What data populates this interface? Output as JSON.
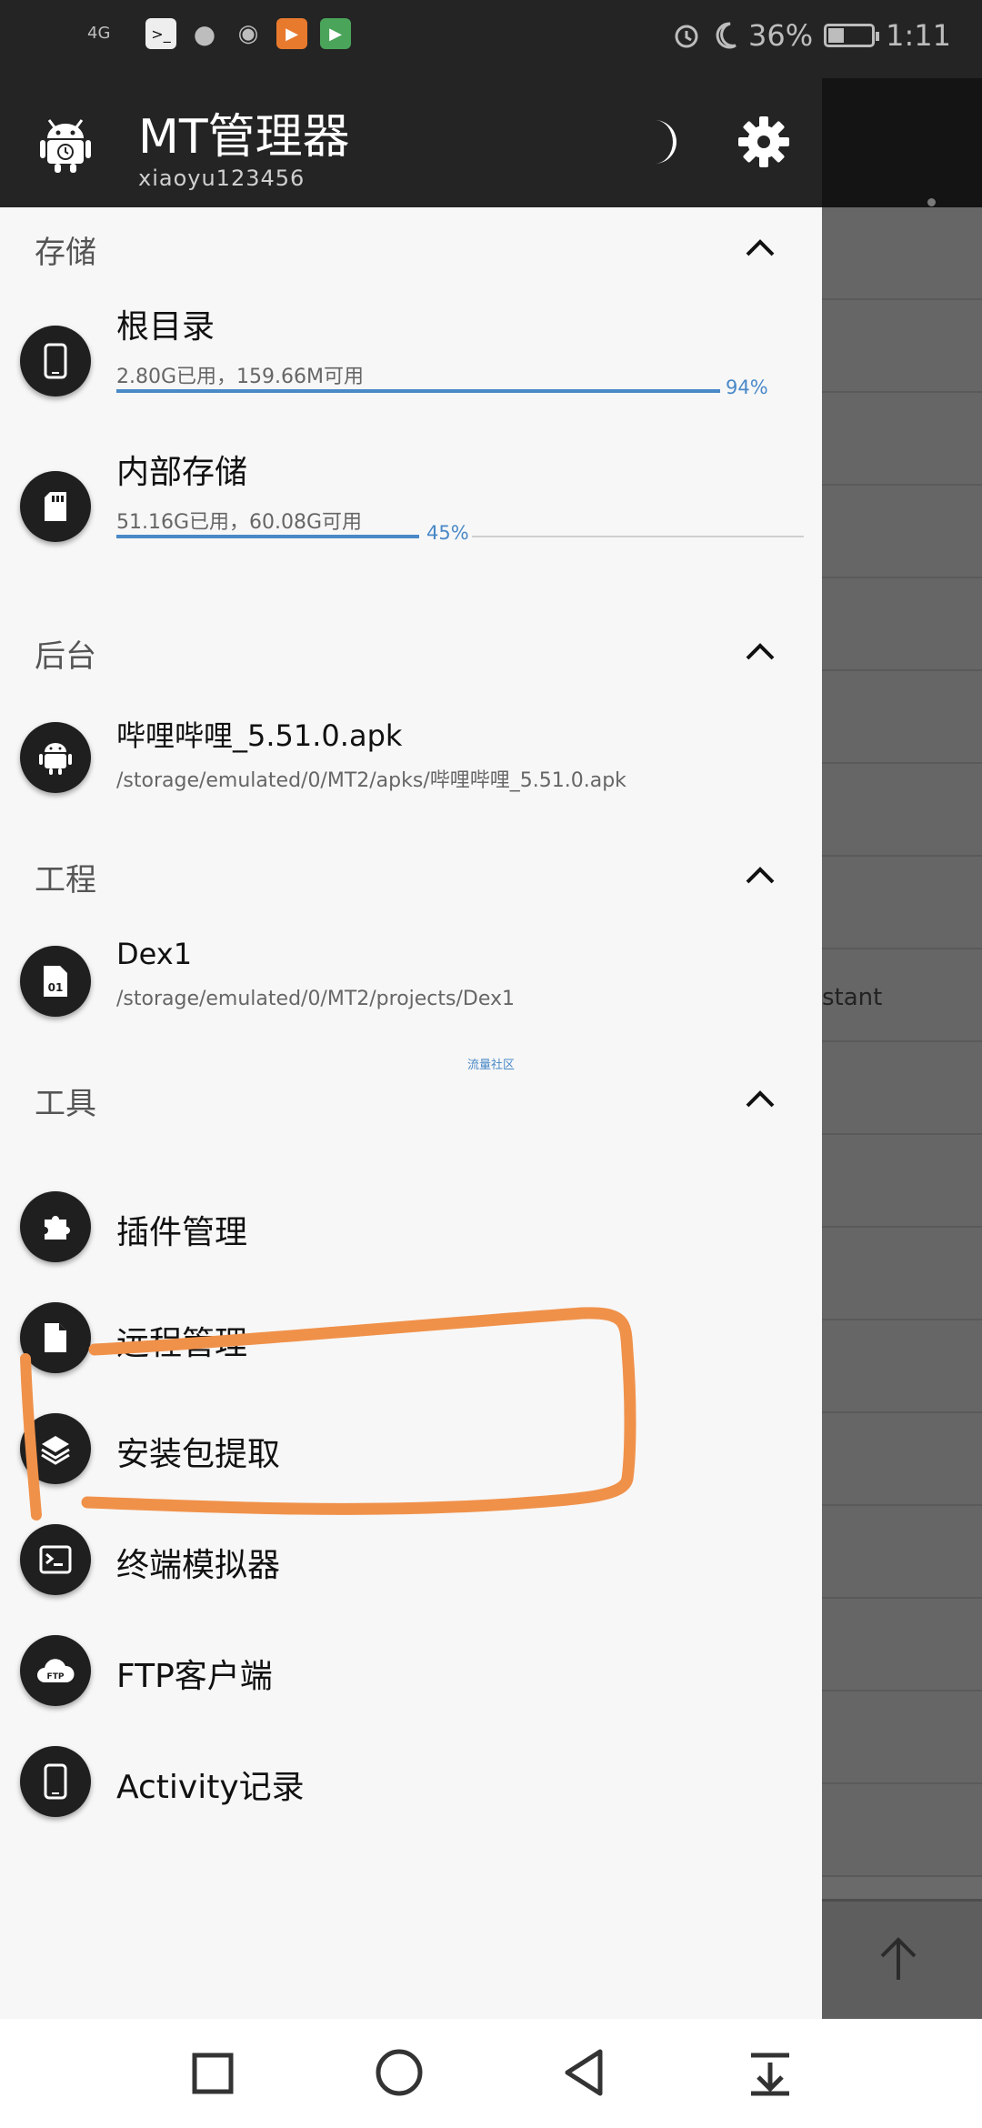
{
  "status_bar": {
    "signal": "4G",
    "battery_percent": "36%",
    "battery_level": 0.36,
    "time": "1:11",
    "icons": [
      "terminal-icon",
      "chat-icon",
      "wechat-icon",
      "video-app-icon",
      "play-app-icon",
      "alarm-icon",
      "moon-icon",
      "battery-icon"
    ]
  },
  "drawer": {
    "app_name": "MT管理器",
    "account": "xiaoyu123456",
    "sections": {
      "storage": {
        "title": "存储",
        "items": [
          {
            "title": "根目录",
            "usage": "2.80G已用，159.66M可用",
            "percent_label": "94%",
            "percent": 94,
            "icon": "phone-icon"
          },
          {
            "title": "内部存储",
            "usage": "51.16G已用，60.08G可用",
            "percent_label": "45%",
            "percent": 45,
            "icon": "sd-card-icon"
          }
        ]
      },
      "background": {
        "title": "后台",
        "items": [
          {
            "title": "哔哩哔哩_5.51.0.apk",
            "path": "/storage/emulated/0/MT2/apks/哔哩哔哩_5.51.0.apk",
            "icon": "android-icon"
          }
        ]
      },
      "project": {
        "title": "工程",
        "items": [
          {
            "title": "Dex1",
            "path": "/storage/emulated/0/MT2/projects/Dex1",
            "icon": "dex-file-icon"
          }
        ]
      },
      "tools": {
        "title": "工具",
        "items": [
          {
            "label": "插件管理",
            "icon": "puzzle-icon"
          },
          {
            "label": "远程管理",
            "icon": "file-icon"
          },
          {
            "label": "安装包提取",
            "icon": "layers-icon"
          },
          {
            "label": "终端模拟器",
            "icon": "terminal-icon"
          },
          {
            "label": "FTP客户端",
            "icon": "ftp-cloud-icon"
          },
          {
            "label": "Activity记录",
            "icon": "phone-icon"
          }
        ]
      }
    },
    "watermark": "流量社区"
  },
  "background_app": {
    "row_fragment": "stant"
  },
  "annotation": {
    "color": "#f0914a",
    "description": "hand-drawn orange outline around 安装包提取"
  },
  "colors": {
    "accent": "#4a89c8",
    "header_bg": "#242424",
    "drawer_bg": "#f7f7f7"
  }
}
